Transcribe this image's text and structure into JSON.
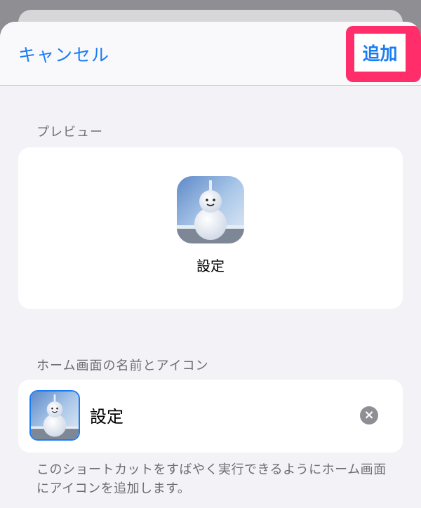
{
  "nav": {
    "cancel_label": "キャンセル",
    "add_label": "追加"
  },
  "preview": {
    "header": "プレビュー",
    "app_label": "設定",
    "icon_name": "snowman-photo-icon"
  },
  "home": {
    "header": "ホーム画面の名前とアイコン",
    "name_value": "設定",
    "icon_name": "snowman-photo-icon",
    "clear_icon": "clear-x-icon"
  },
  "footer": {
    "text": "このショートカットをすばやく実行できるようにホーム画面にアイコンを追加します。"
  },
  "colors": {
    "accent": "#1a7cf5",
    "highlight": "#ff2d6a",
    "background": "#f2f2f7"
  }
}
